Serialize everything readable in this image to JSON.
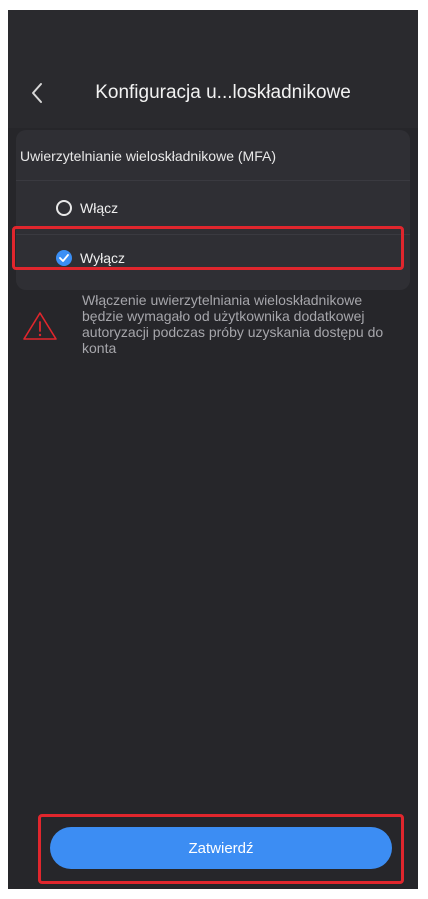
{
  "header": {
    "title": "Konfiguracja u...loskładnikowe",
    "back_icon": "chevron-left-icon"
  },
  "mfa": {
    "section_title": "Uwierzytelnianie wieloskładnikowe (MFA)",
    "options": [
      {
        "label": "Włącz",
        "selected": false
      },
      {
        "label": "Wyłącz",
        "selected": true
      }
    ],
    "warning_icon": "warning-triangle-icon",
    "warning_text": "Włączenie uwierzytelniania wieloskładnikowe będzie wymagało od użytkownika dodatkowej autoryzacji podczas próby uzyskania dostępu do konta"
  },
  "footer": {
    "submit_label": "Zatwierdź"
  },
  "colors": {
    "background": "#26262a",
    "card": "#2f2f34",
    "accent": "#3c8df3",
    "highlight": "#e0262d",
    "warning": "#e0262d"
  }
}
